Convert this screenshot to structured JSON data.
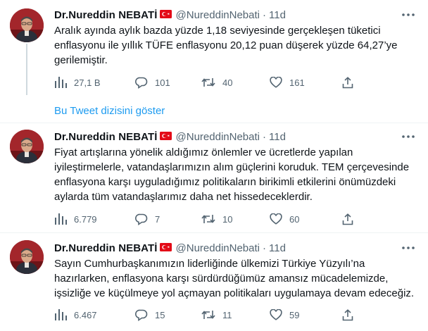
{
  "tweets": [
    {
      "name": "Dr.Nureddin NEBATİ",
      "handle": "@NureddinNebati",
      "time": "11d",
      "lines": [
        "Aralık ayında aylık bazda yüzde 1,18 seviyesinde gerçekleşen tüketici",
        "enflasyonu ile yıllık TÜFE enflasyonu 20,12 puan düşerek yüzde 64,27’ye",
        "gerilemiştir."
      ],
      "views": "27,1 B",
      "replies": "101",
      "retweets": "40",
      "likes": "161"
    },
    {
      "name": "Dr.Nureddin NEBATİ",
      "handle": "@NureddinNebati",
      "time": "11d",
      "lines": [
        "Fiyat artışlarına yönelik aldığımız önlemler ve ücretlerde yapılan",
        "iyileştirmelerle, vatandaşlarımızın alım güçlerini koruduk. TEM çerçevesinde",
        "enflasyona karşı uyguladığımız politikaların birikimli etkilerini önümüzdeki",
        "aylarda tüm vatandaşlarımız daha net hissedeceklerdir."
      ],
      "views": "6.779",
      "replies": "7",
      "retweets": "10",
      "likes": "60"
    },
    {
      "name": "Dr.Nureddin NEBATİ",
      "handle": "@NureddinNebati",
      "time": "11d",
      "lines": [
        "Sayın Cumhurbaşkanımızın liderliğinde ülkemizi Türkiye Yüzyılı’na",
        "hazırlarken, enflasyona karşı sürdürdüğümüz amansız mücadelemizde,",
        "işsizliğe ve küçülmeye yol açmayan politikaları uygulamaya devam edeceğiz."
      ],
      "views": "6.467",
      "replies": "15",
      "retweets": "11",
      "likes": "59"
    }
  ],
  "show_thread": "Bu Tweet dizisini göster",
  "colors": {
    "link": "#1d9bf0",
    "secondary_text": "#536471",
    "flag_red": "#e30a17"
  },
  "icons": [
    "avatar",
    "turkish-flag-icon",
    "more-icon",
    "views-icon",
    "reply-icon",
    "retweet-icon",
    "like-icon",
    "share-icon"
  ]
}
